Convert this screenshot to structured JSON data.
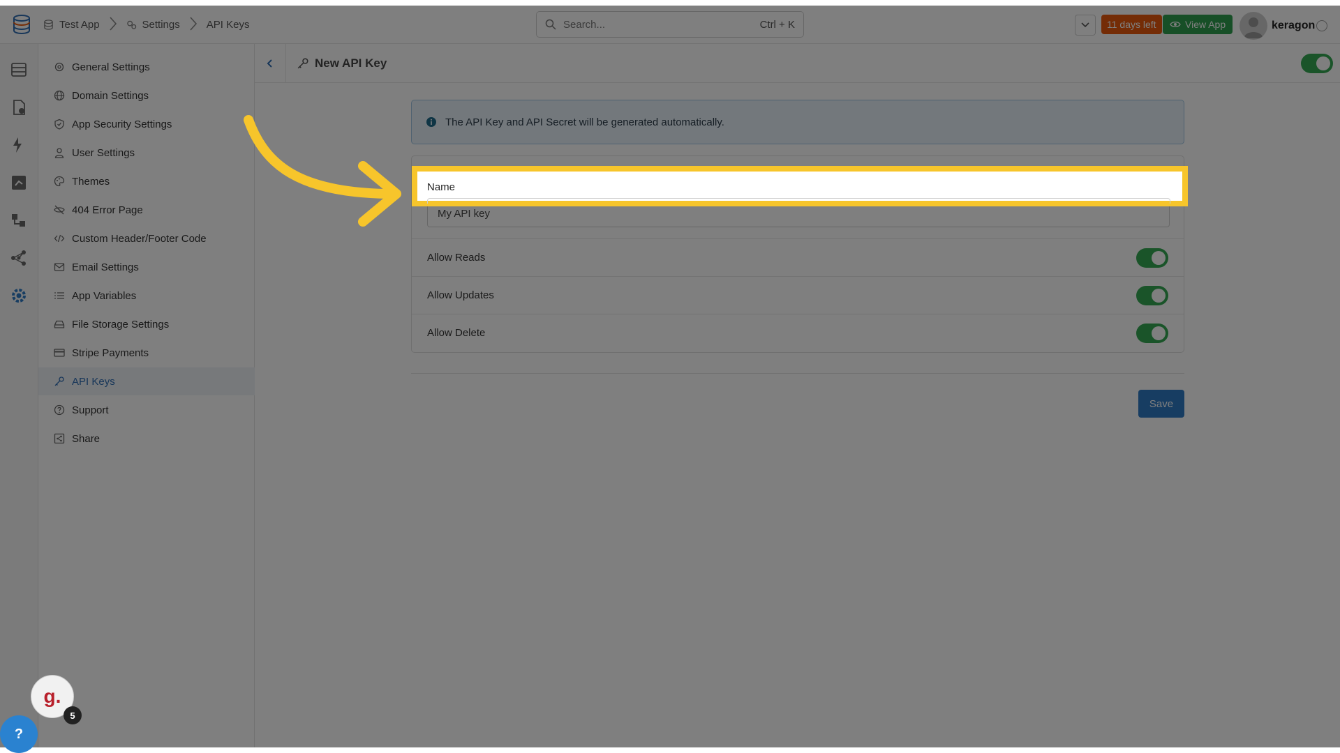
{
  "breadcrumb": {
    "app": "Test App",
    "settings": "Settings",
    "current": "API Keys"
  },
  "search": {
    "placeholder": "Search...",
    "shortcut": "Ctrl + K"
  },
  "header": {
    "trial_badge": "11 days left",
    "view_app": "View App",
    "username": "keragon"
  },
  "sidebar": {
    "items": [
      {
        "label": "General Settings",
        "icon": "gear-icon"
      },
      {
        "label": "Domain Settings",
        "icon": "globe-icon"
      },
      {
        "label": "App Security Settings",
        "icon": "shield-icon"
      },
      {
        "label": "User Settings",
        "icon": "user-icon"
      },
      {
        "label": "Themes",
        "icon": "palette-icon"
      },
      {
        "label": "404 Error Page",
        "icon": "eye-off-icon"
      },
      {
        "label": "Custom Header/Footer Code",
        "icon": "code-icon"
      },
      {
        "label": "Email Settings",
        "icon": "mail-icon"
      },
      {
        "label": "App Variables",
        "icon": "list-icon"
      },
      {
        "label": "File Storage Settings",
        "icon": "drive-icon"
      },
      {
        "label": "Stripe Payments",
        "icon": "card-icon"
      },
      {
        "label": "API Keys",
        "icon": "key-icon",
        "active": true
      },
      {
        "label": "Support",
        "icon": "help-circle-icon"
      },
      {
        "label": "Share",
        "icon": "share-icon"
      }
    ]
  },
  "page": {
    "title": "New API Key",
    "info": "The API Key and API Secret will be generated automatically."
  },
  "form": {
    "name_label": "Name",
    "name_value": "My API key",
    "allow_reads": "Allow Reads",
    "allow_updates": "Allow Updates",
    "allow_delete": "Allow Delete",
    "save": "Save"
  },
  "widgets": {
    "guide_logo": "g.",
    "guide_count": "5",
    "help": "?"
  },
  "colors": {
    "accent": "#2f7bc4",
    "toggle_on": "#34a853",
    "trial": "#e8590c",
    "view_app": "#2e9e4f",
    "highlight": "#f7c52b"
  }
}
